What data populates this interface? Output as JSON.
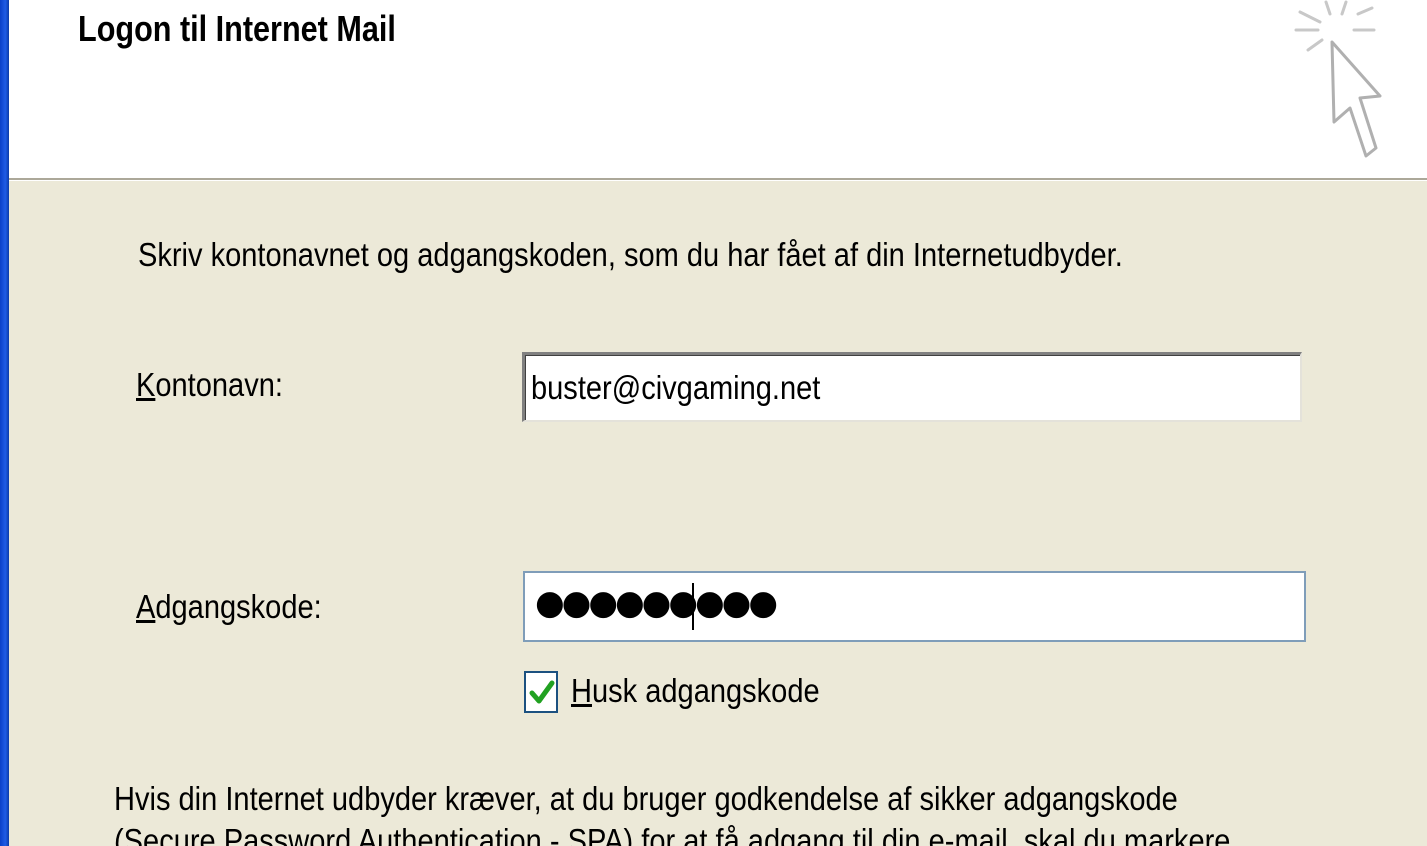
{
  "dialog": {
    "title": "Logon til Internet Mail"
  },
  "form": {
    "intro": "Skriv kontonavnet og adgangskoden, som du har fået af din Internetudbyder.",
    "account_label_key": "K",
    "account_label_rest": "ontonavn:",
    "account_value": "buster@civgaming.net",
    "password_label_key": "A",
    "password_label_rest": "dgangskode:",
    "password_mask": "●●●●●●●●●",
    "remember": {
      "label_key": "H",
      "label_rest": "usk adgangskode",
      "checked": true
    }
  },
  "info": {
    "line1": "Hvis din Internet udbyder kræver, at du bruger godkendelse af sikker adgangskode",
    "line2": "(Secure Password Authentication - SPA) for at få adgang til din e-mail, skal du markere"
  },
  "icons": {
    "wizard": "wizard-sparkle-cursor-icon",
    "checkmark": "checkmark-icon"
  },
  "colors": {
    "window_border": "#1f5ce6",
    "dialog_bg": "#ece9d8",
    "header_bg": "#ffffff",
    "checkmark": "#21a121",
    "input_border": "#7f9db9"
  }
}
